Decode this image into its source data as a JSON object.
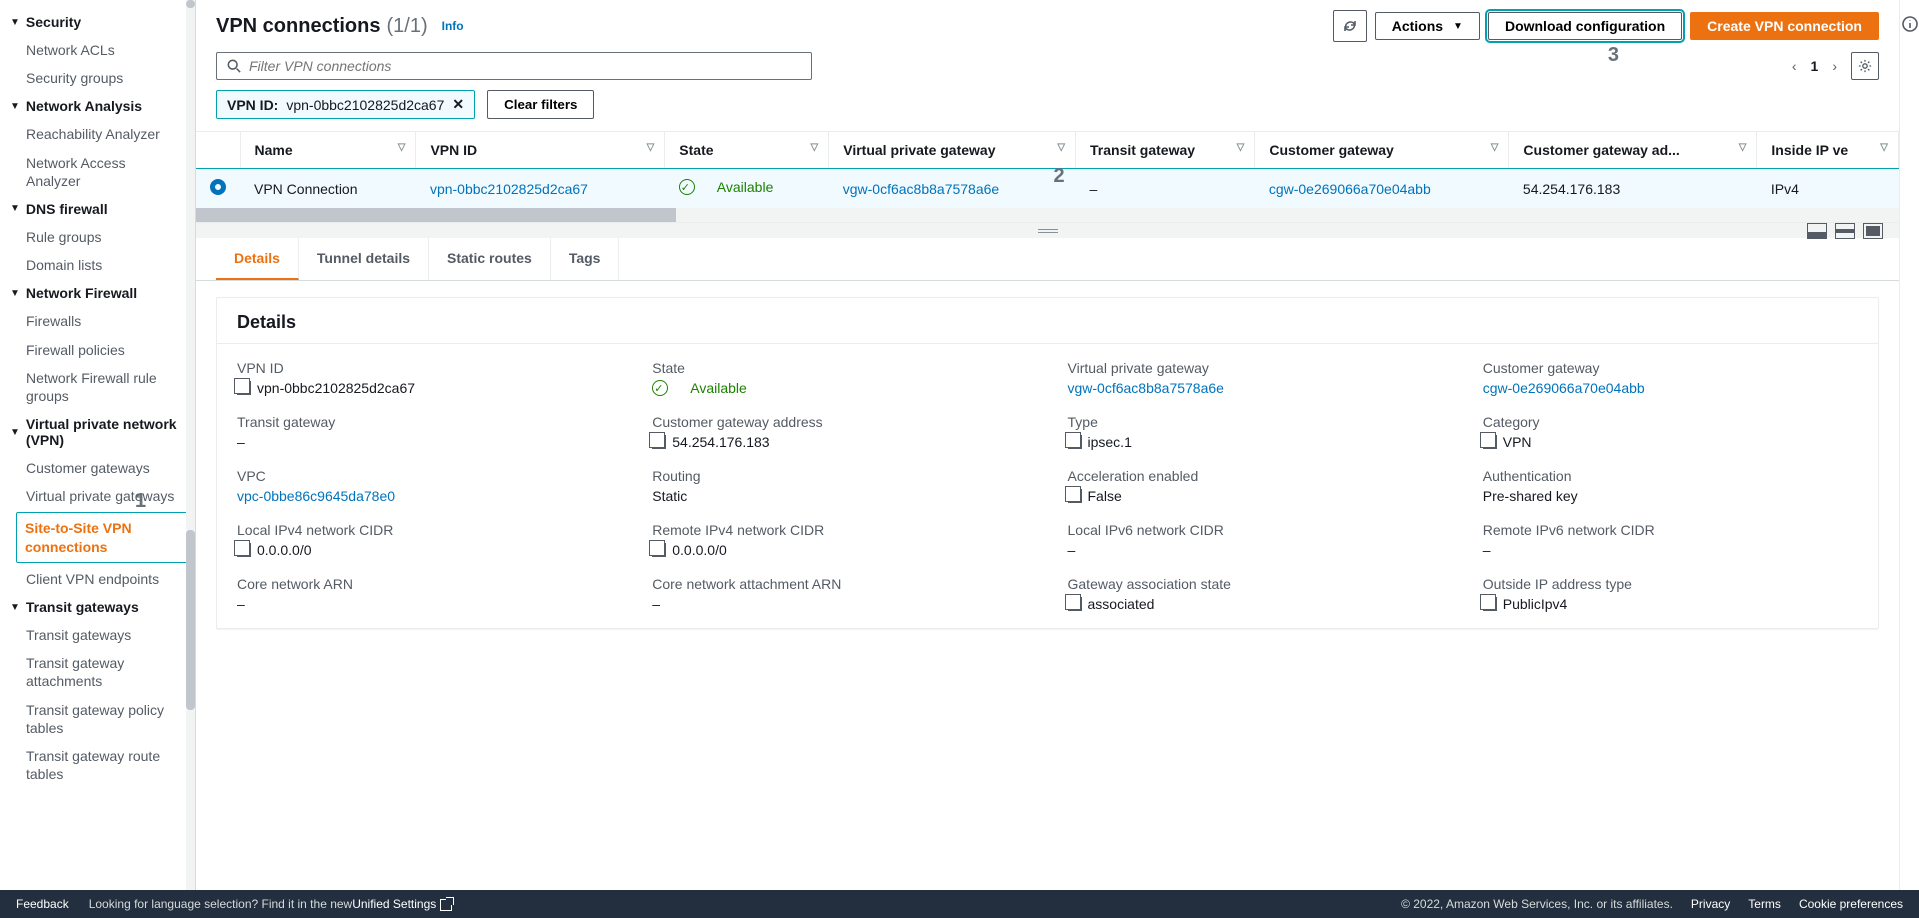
{
  "sidebar": {
    "groups": [
      {
        "label": "Security",
        "items": [
          "Network ACLs",
          "Security groups"
        ]
      },
      {
        "label": "Network Analysis",
        "items": [
          "Reachability Analyzer",
          "Network Access Analyzer"
        ]
      },
      {
        "label": "DNS firewall",
        "items": [
          "Rule groups",
          "Domain lists"
        ]
      },
      {
        "label": "Network Firewall",
        "items": [
          "Firewalls",
          "Firewall policies",
          "Network Firewall rule groups"
        ]
      },
      {
        "label": "Virtual private network (VPN)",
        "items": [
          "Customer gateways",
          "Virtual private gateways",
          "Site-to-Site VPN connections",
          "Client VPN endpoints"
        ]
      },
      {
        "label": "Transit gateways",
        "items": [
          "Transit gateways",
          "Transit gateway attachments",
          "Transit gateway policy tables",
          "Transit gateway route tables"
        ]
      }
    ],
    "active": "Site-to-Site VPN connections"
  },
  "header": {
    "title": "VPN connections",
    "count": "(1/1)",
    "info": "Info",
    "actions_label": "Actions",
    "download_label": "Download configuration",
    "create_label": "Create VPN connection"
  },
  "filter": {
    "placeholder": "Filter VPN connections",
    "chip_key": "VPN ID:",
    "chip_value": "vpn-0bbc2102825d2ca67",
    "clear": "Clear filters",
    "page": "1"
  },
  "table": {
    "cols": [
      "Name",
      "VPN ID",
      "State",
      "Virtual private gateway",
      "Transit gateway",
      "Customer gateway",
      "Customer gateway ad...",
      "Inside IP ve"
    ],
    "row": {
      "name": "VPN Connection",
      "vpn_id": "vpn-0bbc2102825d2ca67",
      "state": "Available",
      "vgw": "vgw-0cf6ac8b8a7578a6e",
      "tgw": "–",
      "cgw": "cgw-0e269066a70e04abb",
      "cgw_addr": "54.254.176.183",
      "inside": "IPv4"
    }
  },
  "tabs": [
    "Details",
    "Tunnel details",
    "Static routes",
    "Tags"
  ],
  "details": {
    "heading": "Details",
    "rows": [
      [
        {
          "k": "VPN ID",
          "v": "vpn-0bbc2102825d2ca67",
          "copy": true
        },
        {
          "k": "State",
          "v": "Available",
          "status": true
        },
        {
          "k": "Virtual private gateway",
          "v": "vgw-0cf6ac8b8a7578a6e",
          "link": true
        },
        {
          "k": "Customer gateway",
          "v": "cgw-0e269066a70e04abb",
          "link": true
        }
      ],
      [
        {
          "k": "Transit gateway",
          "v": "–"
        },
        {
          "k": "Customer gateway address",
          "v": "54.254.176.183",
          "copy": true
        },
        {
          "k": "Type",
          "v": "ipsec.1",
          "copy": true
        },
        {
          "k": "Category",
          "v": "VPN",
          "copy": true
        }
      ],
      [
        {
          "k": "VPC",
          "v": "vpc-0bbe86c9645da78e0",
          "link": true
        },
        {
          "k": "Routing",
          "v": "Static"
        },
        {
          "k": "Acceleration enabled",
          "v": "False",
          "copy": true
        },
        {
          "k": "Authentication",
          "v": "Pre-shared key"
        }
      ],
      [
        {
          "k": "Local IPv4 network CIDR",
          "v": "0.0.0.0/0",
          "copy": true
        },
        {
          "k": "Remote IPv4 network CIDR",
          "v": "0.0.0.0/0",
          "copy": true
        },
        {
          "k": "Local IPv6 network CIDR",
          "v": "–"
        },
        {
          "k": "Remote IPv6 network CIDR",
          "v": "–"
        }
      ],
      [
        {
          "k": "Core network ARN",
          "v": "–"
        },
        {
          "k": "Core network attachment ARN",
          "v": "–"
        },
        {
          "k": "Gateway association state",
          "v": "associated",
          "copy": true
        },
        {
          "k": "Outside IP address type",
          "v": "PublicIpv4",
          "copy": true
        }
      ]
    ]
  },
  "footer": {
    "feedback": "Feedback",
    "lang": "Looking for language selection? Find it in the new ",
    "unified": "Unified Settings",
    "copyright": "© 2022, Amazon Web Services, Inc. or its affiliates.",
    "links": [
      "Privacy",
      "Terms",
      "Cookie preferences"
    ]
  },
  "annotations": {
    "one": "1",
    "two": "2",
    "three": "3"
  }
}
